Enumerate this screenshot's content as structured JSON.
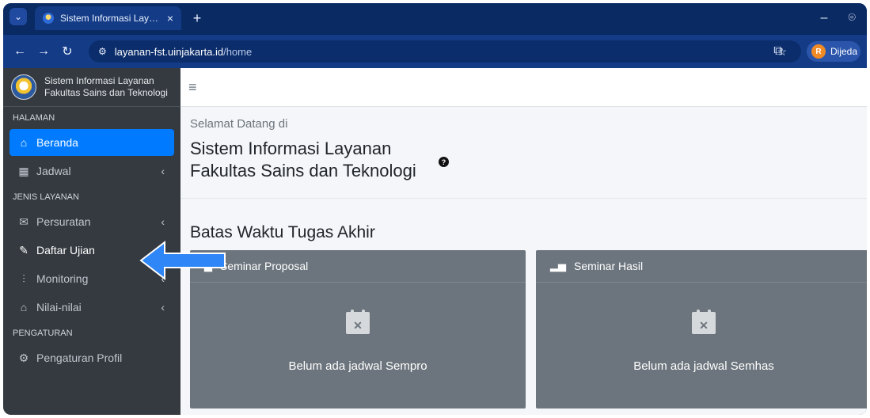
{
  "browser": {
    "tab_title": "Sistem Informasi Layanan FST",
    "tab_close": "×",
    "new_tab": "+",
    "url_host": "layanan-fst.uinjakarta.id",
    "url_path": "/home",
    "profile_initial": "R",
    "profile_name": "Dijeda"
  },
  "brand": {
    "line1": "Sistem Informasi Layanan",
    "line2": "Fakultas Sains dan Teknologi"
  },
  "sidebar": {
    "sections": [
      {
        "label": "HALAMAN"
      },
      {
        "label": "JENIS LAYANAN"
      },
      {
        "label": "PENGATURAN"
      }
    ],
    "items": [
      {
        "label": "Beranda",
        "icon": "home-icon"
      },
      {
        "label": "Jadwal",
        "icon": "calendar-icon"
      },
      {
        "label": "Persuratan",
        "icon": "mail-icon"
      },
      {
        "label": "Daftar Ujian",
        "icon": "edit-icon"
      },
      {
        "label": "Monitoring",
        "icon": "chart-icon"
      },
      {
        "label": "Nilai-nilai",
        "icon": "graduation-cap-icon"
      },
      {
        "label": "Pengaturan Profil",
        "icon": "gears-icon"
      }
    ]
  },
  "main": {
    "welcome": "Selamat Datang di",
    "title_line1": "Sistem Informasi Layanan",
    "title_line2": "Fakultas Sains dan Teknologi",
    "deadline_title": "Batas Waktu Tugas Akhir",
    "cards": [
      {
        "title": "Seminar Proposal",
        "empty_text": "Belum ada jadwal Sempro"
      },
      {
        "title": "Seminar Hasil",
        "empty_text": "Belum ada jadwal Semhas"
      }
    ]
  },
  "colors": {
    "sidebar_bg": "#343a40",
    "active_item": "#007bff",
    "card_bg": "#6c757d",
    "arrow": "#2f86f6"
  }
}
